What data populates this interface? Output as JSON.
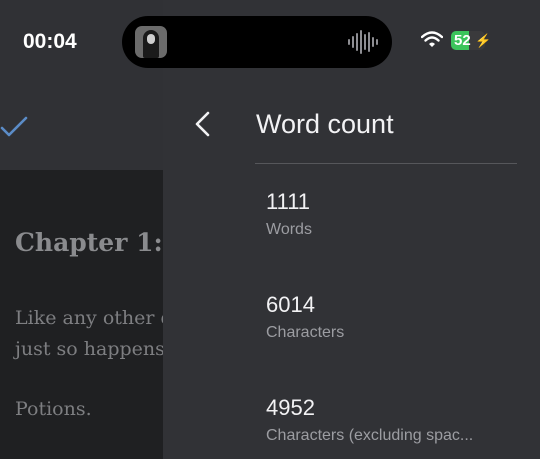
{
  "status_bar": {
    "time": "00:04",
    "battery_percent": "52"
  },
  "document": {
    "heading": "Chapter 1:",
    "lines": [
      "Like any other d",
      "just so happens t",
      "Potions."
    ]
  },
  "panel": {
    "title": "Word count",
    "stats": [
      {
        "value": "1111",
        "label": "Words"
      },
      {
        "value": "6014",
        "label": "Characters"
      },
      {
        "value": "4952",
        "label": "Characters (excluding spac..."
      }
    ]
  },
  "colors": {
    "accent": "#5b8cc7",
    "panel_bg": "#313236",
    "battery_green": "#3cc45c"
  }
}
